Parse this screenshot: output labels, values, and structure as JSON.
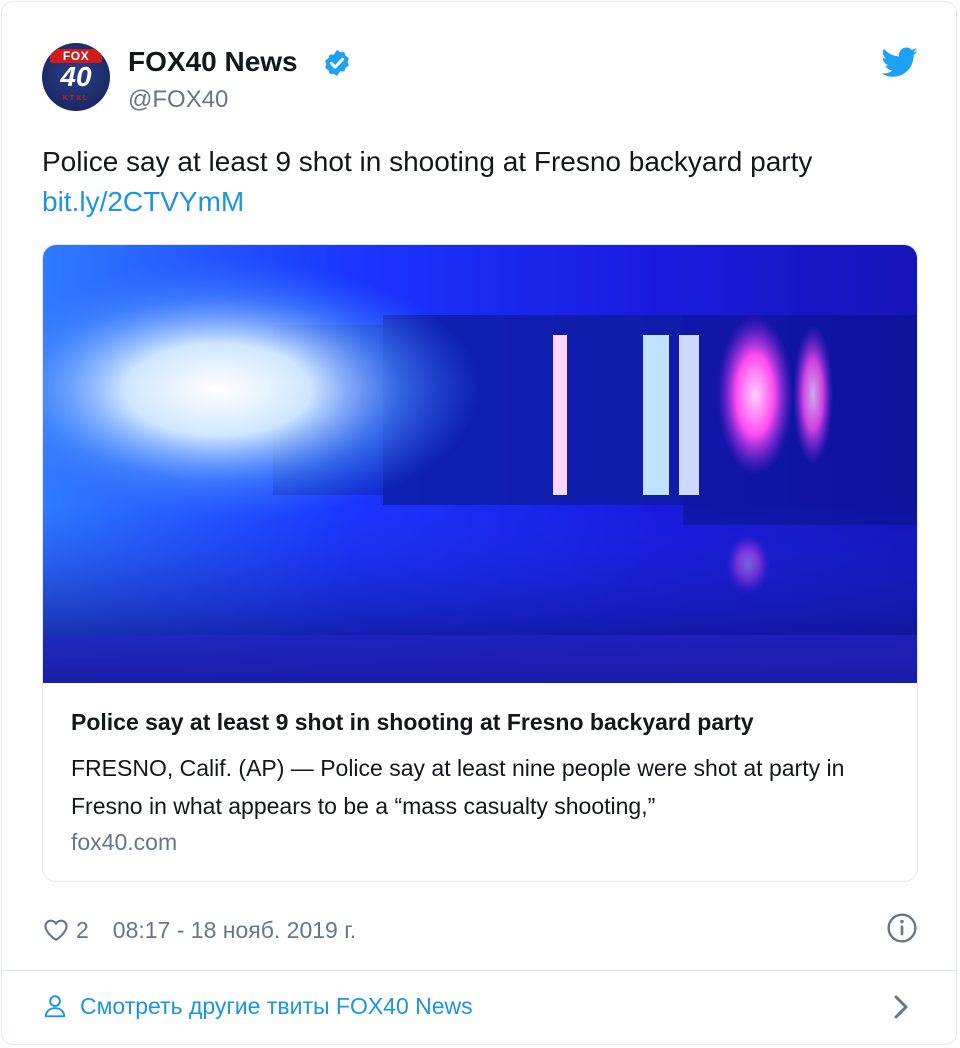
{
  "account": {
    "name": "FOX40 News",
    "handle": "@FOX40",
    "avatar_top": "FOX",
    "avatar_num": "40",
    "avatar_bottom": "KTXL"
  },
  "tweet": {
    "text": "Police say at least 9 shot in shooting at Fresno backyard party",
    "link": "bit.ly/2CTVYmM"
  },
  "card": {
    "title": "Police say at least 9 shot in shooting at Fresno backyard party",
    "description": "FRESNO, Calif. (AP) — Police say at least nine people were shot at party in Fresno in what appears to be a “mass casualty shooting,”",
    "domain": "fox40.com"
  },
  "meta": {
    "likes": "2",
    "timestamp": "08:17 - 18 нояб. 2019 г."
  },
  "footer": {
    "label": "Смотреть другие твиты FOX40 News"
  },
  "icons": {
    "verified": "verified-badge-icon",
    "twitter": "twitter-bird-icon",
    "heart": "heart-icon",
    "info": "info-icon",
    "person": "person-icon",
    "chevron": "chevron-right-icon"
  },
  "colors": {
    "link_blue": "#1b95e0",
    "twitter_blue": "#1da1f2",
    "secondary_text": "#657786"
  }
}
